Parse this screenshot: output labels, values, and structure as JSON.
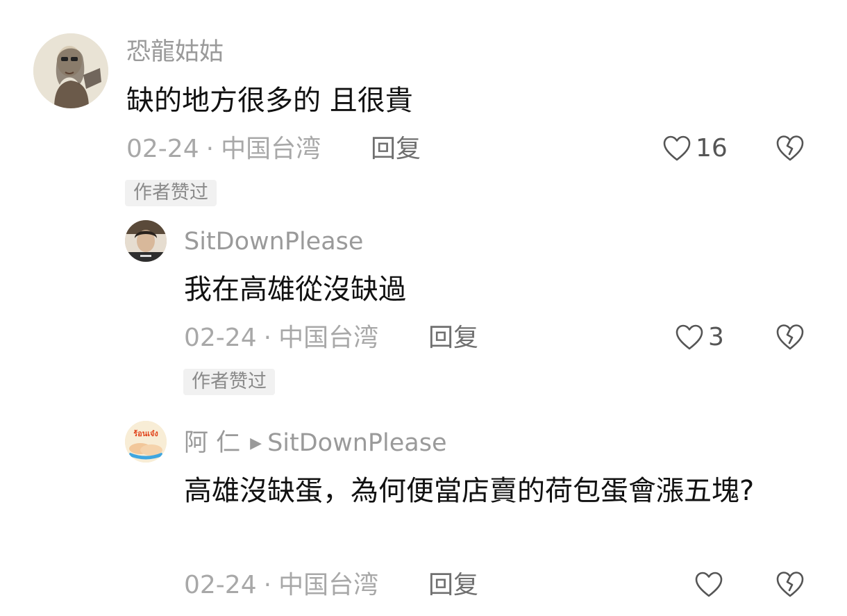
{
  "comments": [
    {
      "username": "恐龍姑姑",
      "text": "缺的地方很多的 且很貴",
      "date": "02-24",
      "location": "中国台湾",
      "reply_label": "回复",
      "likes": "16",
      "badge": "作者赞过",
      "avatar_icon": "sketch-portrait-avatar"
    },
    {
      "username": "SitDownPlease",
      "text": "我在高雄從沒缺過",
      "date": "02-24",
      "location": "中国台湾",
      "reply_label": "回复",
      "likes": "3",
      "badge": "作者赞过",
      "avatar_icon": "photo-avatar"
    },
    {
      "username": "阿 仁",
      "reply_to": "SitDownPlease",
      "text": "高雄沒缺蛋，為何便當店賣的荷包蛋會漲五塊?",
      "date": "02-24",
      "location": "中国台湾",
      "reply_label": "回复",
      "likes": "",
      "avatar_icon": "hands-logo-avatar",
      "avatar_text": "ร้อนเจ๋ง"
    }
  ],
  "separator": "·",
  "colors": {
    "meta_gray": "#a8a8a8",
    "username_gray": "#9a9a9a",
    "badge_bg": "#f1f1f1",
    "text_black": "#111111"
  }
}
